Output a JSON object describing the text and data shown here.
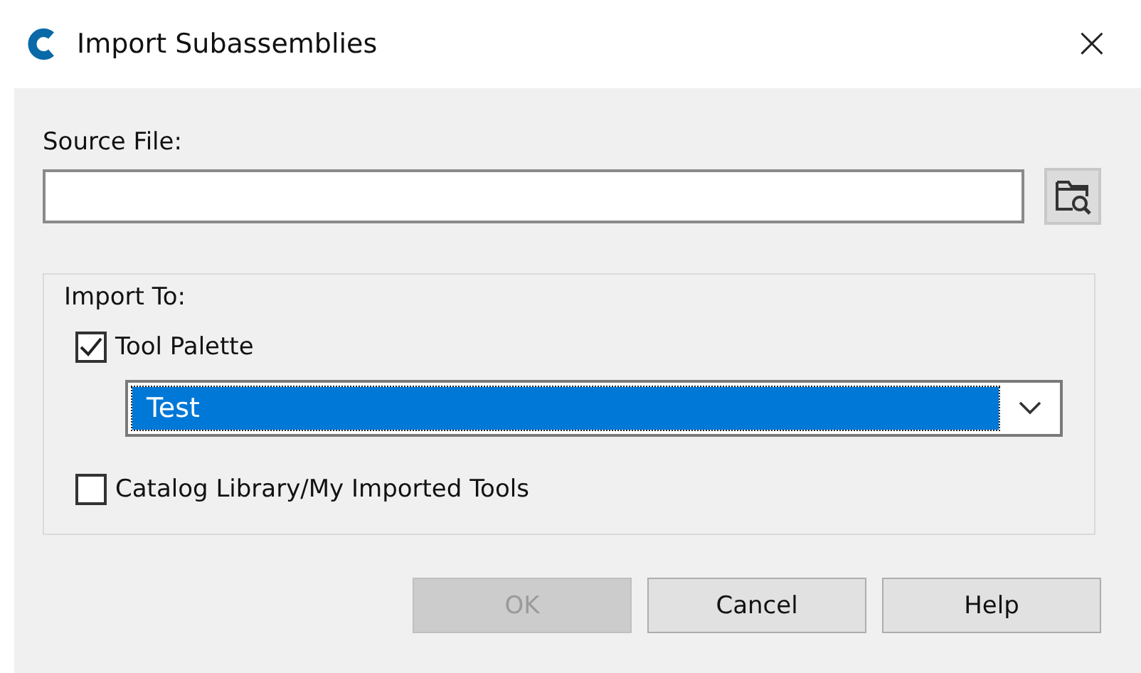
{
  "window": {
    "title": "Import Subassemblies",
    "close": "×"
  },
  "source_file": {
    "label": "Source File:"
  },
  "import_to": {
    "label": "Import To:",
    "tool_palette": {
      "label": "Tool Palette",
      "checked": true
    },
    "palette_select": {
      "value": "Test"
    },
    "catalog": {
      "label": "Catalog Library/My Imported Tools",
      "checked": false
    }
  },
  "buttons": [
    {
      "label": "OK",
      "disabled": true
    },
    {
      "label": "Cancel",
      "disabled": false
    },
    {
      "label": "Help",
      "disabled": false
    }
  ]
}
